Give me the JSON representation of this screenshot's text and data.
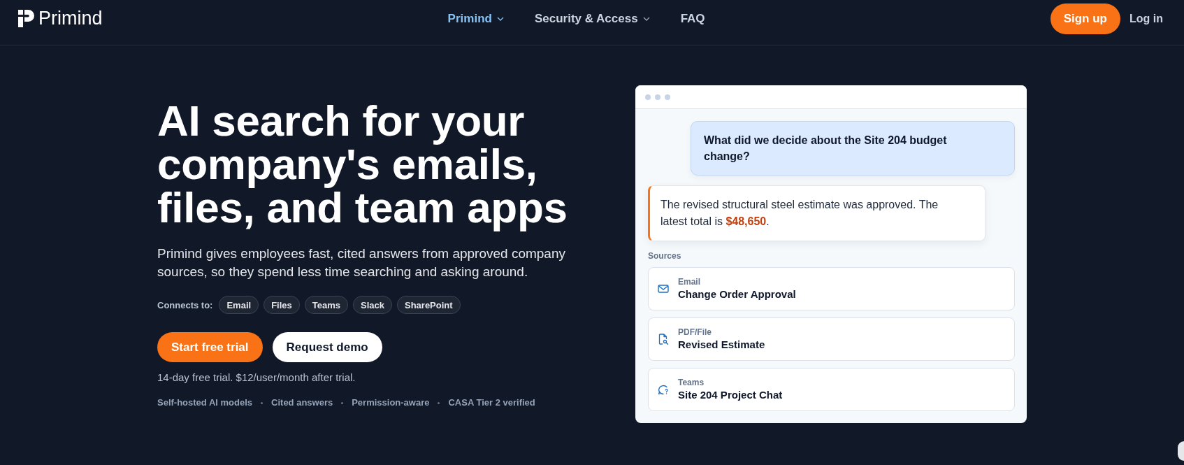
{
  "header": {
    "logo": {
      "text": "Primind"
    },
    "nav": [
      {
        "label": "Primind",
        "selected": true,
        "dropdown": true
      },
      {
        "label": "Security & Access",
        "selected": false,
        "dropdown": true
      },
      {
        "label": "FAQ",
        "selected": false,
        "dropdown": false
      }
    ],
    "actions": [
      {
        "label": "Sign up",
        "kind": "primary"
      },
      {
        "label": "Log in",
        "kind": "link"
      }
    ]
  },
  "hero": {
    "heading": "AI search for your company's emails, files, and team apps",
    "description": "Primind gives employees fast, cited answers from approved company sources, so they spend less time searching and asking around.",
    "connects_label": "Connects to:",
    "connectors": [
      "Email",
      "Files",
      "Teams",
      "Slack",
      "SharePoint"
    ],
    "buttons": [
      {
        "label": "Start free trial",
        "kind": "primary"
      },
      {
        "label": "Request demo",
        "kind": "secondary"
      }
    ],
    "trial_note": "14-day free trial. $12/user/month after trial.",
    "features": [
      "Self-hosted AI models",
      "Cited answers",
      "Permission-aware",
      "CASA Tier 2 verified"
    ]
  },
  "chat_preview": {
    "question": "What did we decide about the Site 204 budget change?",
    "answer": "The revised structural steel estimate was approved. The latest total is **$48,650**.",
    "sources_label": "Sources",
    "sources": [
      {
        "kind": "email",
        "type_label": "Email",
        "title": "Change Order Approval"
      },
      {
        "kind": "file",
        "type_label": "PDF/File",
        "title": "Revised Estimate"
      },
      {
        "kind": "teams",
        "type_label": "Teams",
        "title": "Site 204 Project Chat"
      }
    ]
  }
}
